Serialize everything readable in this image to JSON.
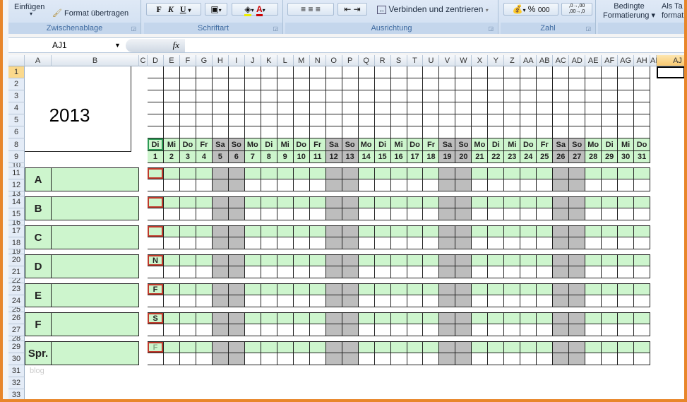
{
  "ribbon": {
    "paste_label": "Einfügen",
    "format_painter": "Format übertragen",
    "clipboard_group": "Zwischenablage",
    "bold": "F",
    "italic": "K",
    "underline": "U",
    "font_group": "Schriftart",
    "merge_center": "Verbinden und zentrieren",
    "alignment_group": "Ausrichtung",
    "percent": "%",
    "thousands": "000",
    "inc_decimal": ",0→,00",
    "dec_decimal": ",00→,0",
    "number_group": "Zahl",
    "cond_format_1": "Bedingte",
    "cond_format_2": "Formatierung",
    "as_table_1": "Als Ta",
    "as_table_2": "format"
  },
  "formula_bar": {
    "name_box": "AJ1",
    "fx": "fx",
    "formula": ""
  },
  "columns": [
    "A",
    "B",
    "C",
    "D",
    "E",
    "F",
    "G",
    "H",
    "I",
    "J",
    "K",
    "L",
    "M",
    "N",
    "O",
    "P",
    "Q",
    "R",
    "S",
    "T",
    "U",
    "V",
    "W",
    "X",
    "Y",
    "Z",
    "AA",
    "AB",
    "AC",
    "AD",
    "AE",
    "AF",
    "AG",
    "AH",
    "AI",
    "AJ"
  ],
  "sheet": {
    "year": "2013",
    "weekdays": [
      "Di",
      "Mi",
      "Do",
      "Fr",
      "Sa",
      "So",
      "Mo",
      "Di",
      "Mi",
      "Do",
      "Fr",
      "Sa",
      "So",
      "Mo",
      "Di",
      "Mi",
      "Do",
      "Fr",
      "Sa",
      "So",
      "Mo",
      "Di",
      "Mi",
      "Do",
      "Fr",
      "Sa",
      "So",
      "Mo",
      "Di",
      "Mi",
      "Do"
    ],
    "days": [
      "1",
      "2",
      "3",
      "4",
      "5",
      "6",
      "7",
      "8",
      "9",
      "10",
      "11",
      "12",
      "13",
      "14",
      "15",
      "16",
      "17",
      "18",
      "19",
      "20",
      "21",
      "22",
      "23",
      "24",
      "25",
      "26",
      "27",
      "28",
      "29",
      "30",
      "31"
    ],
    "weekend_days": [
      5,
      6,
      12,
      13,
      19,
      20,
      26,
      27
    ],
    "groups": [
      {
        "label": "A",
        "first_cell": "",
        "rows": [
          "11",
          "12"
        ]
      },
      {
        "label": "B",
        "first_cell": "",
        "rows": [
          "14",
          "15"
        ]
      },
      {
        "label": "C",
        "first_cell": "",
        "rows": [
          "17",
          "18"
        ]
      },
      {
        "label": "D",
        "first_cell": "N",
        "rows": [
          "20",
          "21"
        ]
      },
      {
        "label": "E",
        "first_cell": "F",
        "rows": [
          "23",
          "24"
        ]
      },
      {
        "label": "F",
        "first_cell": "S",
        "rows": [
          "26",
          "27"
        ]
      },
      {
        "label": "Spr.",
        "first_cell": "F",
        "rows": [
          "29",
          "30"
        ]
      }
    ],
    "watermark": "blog"
  },
  "colors": {
    "green": "#cdf5cd",
    "weekend": "#bdbdbd",
    "marker": "#c0392b",
    "frame": "#e8862a"
  }
}
